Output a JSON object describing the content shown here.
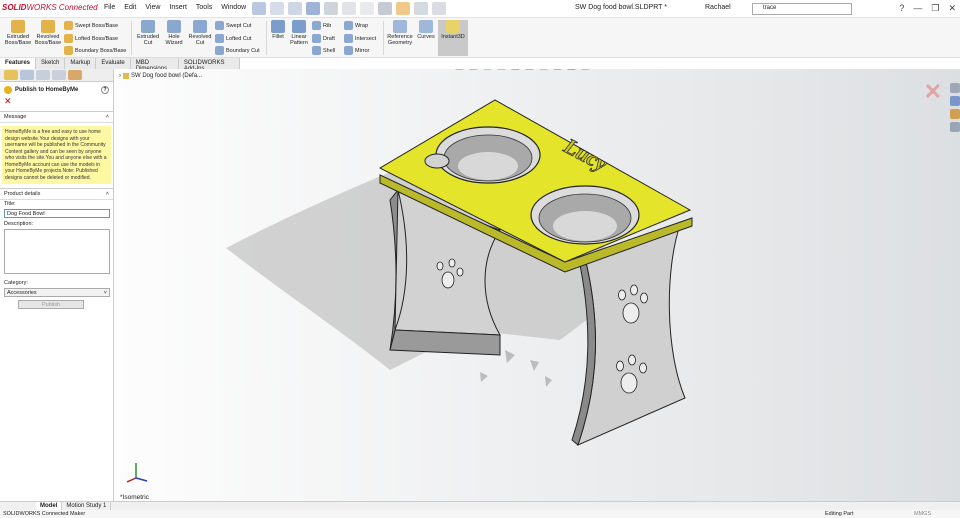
{
  "app": {
    "brand_a": "SOLID",
    "brand_b": "WORKS Connected",
    "doc_title": "SW Dog food bowl.SLDPRT *",
    "user": "Rachael",
    "search_value": "trace"
  },
  "menus": [
    "File",
    "Edit",
    "View",
    "Insert",
    "Tools",
    "Window"
  ],
  "window_controls": [
    "?",
    "—",
    "❐",
    "✕"
  ],
  "ribbon": {
    "extruded_boss": "Extruded Boss/Base",
    "revolved_boss": "Revolved Boss/Base",
    "swept_boss": "Swept Boss/Base",
    "lofted_boss": "Lofted Boss/Base",
    "boundary_boss": "Boundary Boss/Base",
    "extruded_cut": "Extruded Cut",
    "hole_wizard": "Hole Wizard",
    "revolved_cut": "Revolved Cut",
    "swept_cut": "Swept Cut",
    "lofted_cut": "Lofted Cut",
    "boundary_cut": "Boundary Cut",
    "fillet": "Fillet",
    "linear_pattern": "Linear Pattern",
    "rib": "Rib",
    "draft": "Draft",
    "shell": "Shell",
    "wrap": "Wrap",
    "intersect": "Intersect",
    "mirror": "Mirror",
    "reference_geometry": "Reference Geometry",
    "curves": "Curves",
    "instant3d": "Instant3D"
  },
  "command_tabs": [
    "Features",
    "Sketch",
    "Markup",
    "Evaluate",
    "MBD Dimensions",
    "SOLIDWORKS Add-Ins"
  ],
  "panel": {
    "title": "Publish to HomeByMe",
    "help": "?",
    "close": "✕",
    "message_header": "Message",
    "message": "HomeByMe is a free and easy to use home design website.Your designs with your username will be published in the Community Content gallery and can be seen by anyone who visits the site.You and anyone else with a HomeByMe account can use the models in your HomeByMe projects.Note: Published designs cannot be deleted or modified.",
    "details_header": "Product details",
    "title_label": "Title:",
    "title_value": "Dog Food Bowl",
    "description_label": "Description:",
    "description_value": "",
    "category_label": "Category:",
    "category_value": "Accessories",
    "publish_label": "Publish"
  },
  "viewport": {
    "tree_item": "SW Dog food bowl (Defa...",
    "view_label": "*Isometric",
    "engraving": "Lucy"
  },
  "bottom_tabs": [
    "Model",
    "Motion Study 1"
  ],
  "status": {
    "left": "SOLIDWORKS Connected Maker",
    "mode": "Editing Part",
    "units": "MMGS"
  },
  "colors": {
    "brand_red": "#c8102e",
    "tabletop_yellow": "#e4e42a",
    "leg_gray": "#cfcfcf",
    "message_bg": "#fff8a3"
  }
}
